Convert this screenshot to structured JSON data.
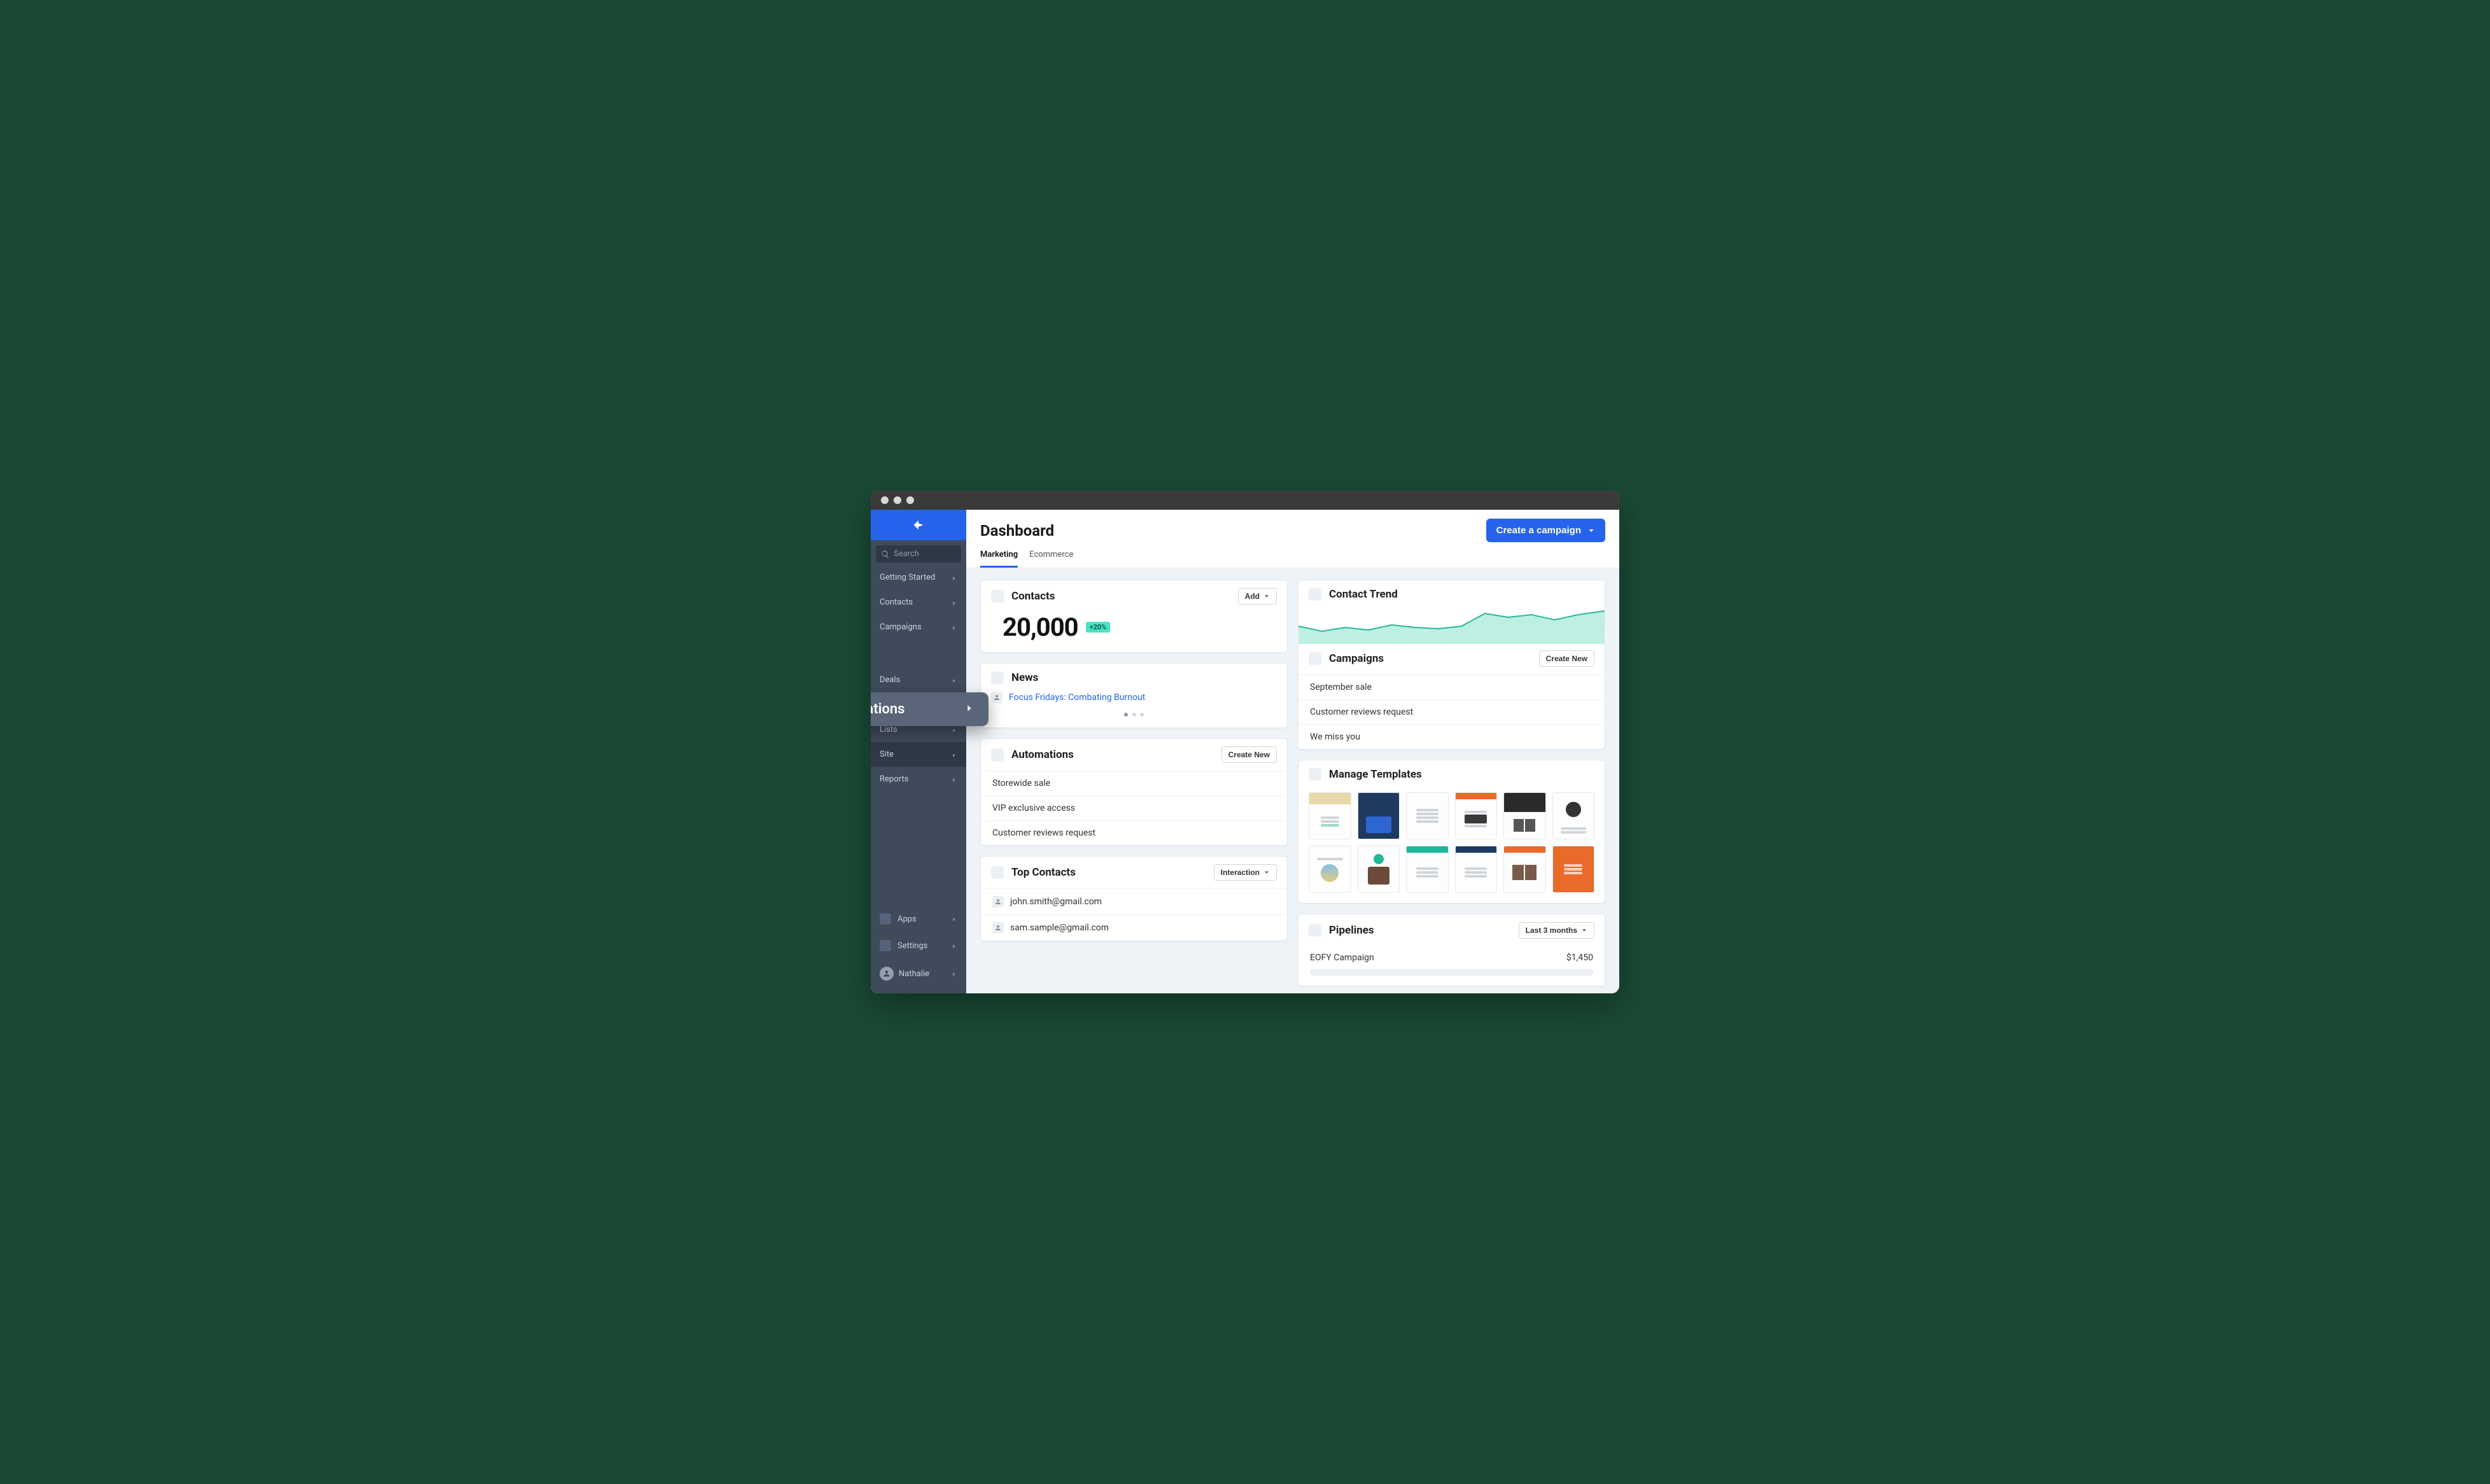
{
  "header": {
    "title": "Dashboard",
    "cta_label": "Create a campaign",
    "tabs": [
      "Marketing",
      "Ecommerce"
    ],
    "active_tab": 0
  },
  "sidebar": {
    "search_placeholder": "Search",
    "items": [
      "Getting Started",
      "Contacts",
      "Campaigns",
      "Deals",
      "Conversations",
      "Lists",
      "Site",
      "Reports"
    ],
    "active_item": "Site",
    "bottom": [
      "Apps",
      "Settings"
    ],
    "user_name": "Nathalie",
    "highlighted_label": "Automations"
  },
  "contacts_card": {
    "title": "Contacts",
    "value": "20,000",
    "delta": "+20%",
    "button": "Add"
  },
  "trend_card": {
    "title": "Contact Trend"
  },
  "news_card": {
    "title": "News",
    "headline": "Focus Fridays: Combating Burnout"
  },
  "campaigns_card": {
    "title": "Campaigns",
    "button": "Create New",
    "items": [
      "September sale",
      "Customer reviews request",
      "We miss you"
    ]
  },
  "automations_card": {
    "title": "Automations",
    "button": "Create New",
    "items": [
      "Storewide sale",
      "VIP exclusive access",
      "Customer reviews request"
    ]
  },
  "templates_card": {
    "title": "Manage Templates"
  },
  "top_contacts_card": {
    "title": "Top Contacts",
    "button": "Interaction",
    "items": [
      "john.smith@gmail.com",
      "sam.sample@gmail.com"
    ]
  },
  "pipelines_card": {
    "title": "Pipelines",
    "filter": "Last 3 months",
    "items": [
      {
        "name": "EOFY Campaign",
        "value": "$1,450"
      }
    ]
  },
  "chart_data": {
    "type": "area",
    "title": "Contact Trend",
    "x": [
      0,
      1,
      2,
      3,
      4,
      5,
      6,
      7,
      8,
      9,
      10,
      11,
      12,
      13
    ],
    "values": [
      32,
      24,
      30,
      26,
      34,
      30,
      28,
      32,
      50,
      44,
      48,
      40,
      48,
      54
    ],
    "ylim": [
      0,
      60
    ]
  }
}
